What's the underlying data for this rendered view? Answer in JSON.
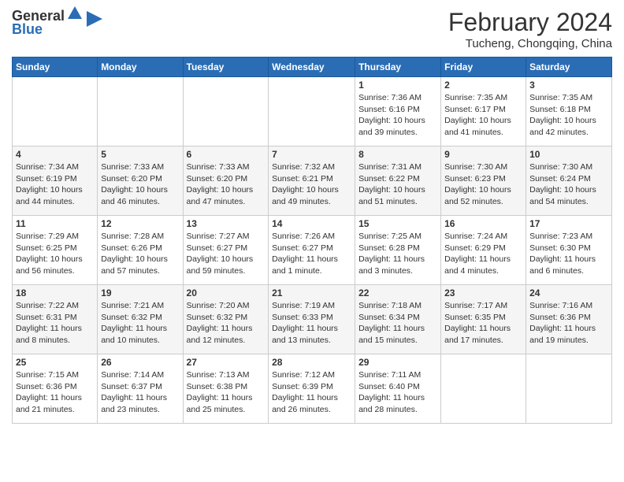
{
  "logo": {
    "line1": "General",
    "line2": "Blue"
  },
  "title": "February 2024",
  "subtitle": "Tucheng, Chongqing, China",
  "days_of_week": [
    "Sunday",
    "Monday",
    "Tuesday",
    "Wednesday",
    "Thursday",
    "Friday",
    "Saturday"
  ],
  "weeks": [
    [
      {
        "day": "",
        "info": ""
      },
      {
        "day": "",
        "info": ""
      },
      {
        "day": "",
        "info": ""
      },
      {
        "day": "",
        "info": ""
      },
      {
        "day": "1",
        "info": "Sunrise: 7:36 AM\nSunset: 6:16 PM\nDaylight: 10 hours\nand 39 minutes."
      },
      {
        "day": "2",
        "info": "Sunrise: 7:35 AM\nSunset: 6:17 PM\nDaylight: 10 hours\nand 41 minutes."
      },
      {
        "day": "3",
        "info": "Sunrise: 7:35 AM\nSunset: 6:18 PM\nDaylight: 10 hours\nand 42 minutes."
      }
    ],
    [
      {
        "day": "4",
        "info": "Sunrise: 7:34 AM\nSunset: 6:19 PM\nDaylight: 10 hours\nand 44 minutes."
      },
      {
        "day": "5",
        "info": "Sunrise: 7:33 AM\nSunset: 6:20 PM\nDaylight: 10 hours\nand 46 minutes."
      },
      {
        "day": "6",
        "info": "Sunrise: 7:33 AM\nSunset: 6:20 PM\nDaylight: 10 hours\nand 47 minutes."
      },
      {
        "day": "7",
        "info": "Sunrise: 7:32 AM\nSunset: 6:21 PM\nDaylight: 10 hours\nand 49 minutes."
      },
      {
        "day": "8",
        "info": "Sunrise: 7:31 AM\nSunset: 6:22 PM\nDaylight: 10 hours\nand 51 minutes."
      },
      {
        "day": "9",
        "info": "Sunrise: 7:30 AM\nSunset: 6:23 PM\nDaylight: 10 hours\nand 52 minutes."
      },
      {
        "day": "10",
        "info": "Sunrise: 7:30 AM\nSunset: 6:24 PM\nDaylight: 10 hours\nand 54 minutes."
      }
    ],
    [
      {
        "day": "11",
        "info": "Sunrise: 7:29 AM\nSunset: 6:25 PM\nDaylight: 10 hours\nand 56 minutes."
      },
      {
        "day": "12",
        "info": "Sunrise: 7:28 AM\nSunset: 6:26 PM\nDaylight: 10 hours\nand 57 minutes."
      },
      {
        "day": "13",
        "info": "Sunrise: 7:27 AM\nSunset: 6:27 PM\nDaylight: 10 hours\nand 59 minutes."
      },
      {
        "day": "14",
        "info": "Sunrise: 7:26 AM\nSunset: 6:27 PM\nDaylight: 11 hours\nand 1 minute."
      },
      {
        "day": "15",
        "info": "Sunrise: 7:25 AM\nSunset: 6:28 PM\nDaylight: 11 hours\nand 3 minutes."
      },
      {
        "day": "16",
        "info": "Sunrise: 7:24 AM\nSunset: 6:29 PM\nDaylight: 11 hours\nand 4 minutes."
      },
      {
        "day": "17",
        "info": "Sunrise: 7:23 AM\nSunset: 6:30 PM\nDaylight: 11 hours\nand 6 minutes."
      }
    ],
    [
      {
        "day": "18",
        "info": "Sunrise: 7:22 AM\nSunset: 6:31 PM\nDaylight: 11 hours\nand 8 minutes."
      },
      {
        "day": "19",
        "info": "Sunrise: 7:21 AM\nSunset: 6:32 PM\nDaylight: 11 hours\nand 10 minutes."
      },
      {
        "day": "20",
        "info": "Sunrise: 7:20 AM\nSunset: 6:32 PM\nDaylight: 11 hours\nand 12 minutes."
      },
      {
        "day": "21",
        "info": "Sunrise: 7:19 AM\nSunset: 6:33 PM\nDaylight: 11 hours\nand 13 minutes."
      },
      {
        "day": "22",
        "info": "Sunrise: 7:18 AM\nSunset: 6:34 PM\nDaylight: 11 hours\nand 15 minutes."
      },
      {
        "day": "23",
        "info": "Sunrise: 7:17 AM\nSunset: 6:35 PM\nDaylight: 11 hours\nand 17 minutes."
      },
      {
        "day": "24",
        "info": "Sunrise: 7:16 AM\nSunset: 6:36 PM\nDaylight: 11 hours\nand 19 minutes."
      }
    ],
    [
      {
        "day": "25",
        "info": "Sunrise: 7:15 AM\nSunset: 6:36 PM\nDaylight: 11 hours\nand 21 minutes."
      },
      {
        "day": "26",
        "info": "Sunrise: 7:14 AM\nSunset: 6:37 PM\nDaylight: 11 hours\nand 23 minutes."
      },
      {
        "day": "27",
        "info": "Sunrise: 7:13 AM\nSunset: 6:38 PM\nDaylight: 11 hours\nand 25 minutes."
      },
      {
        "day": "28",
        "info": "Sunrise: 7:12 AM\nSunset: 6:39 PM\nDaylight: 11 hours\nand 26 minutes."
      },
      {
        "day": "29",
        "info": "Sunrise: 7:11 AM\nSunset: 6:40 PM\nDaylight: 11 hours\nand 28 minutes."
      },
      {
        "day": "",
        "info": ""
      },
      {
        "day": "",
        "info": ""
      }
    ]
  ],
  "colors": {
    "header_bg": "#2a6db5",
    "header_text": "#ffffff",
    "border": "#cccccc"
  }
}
